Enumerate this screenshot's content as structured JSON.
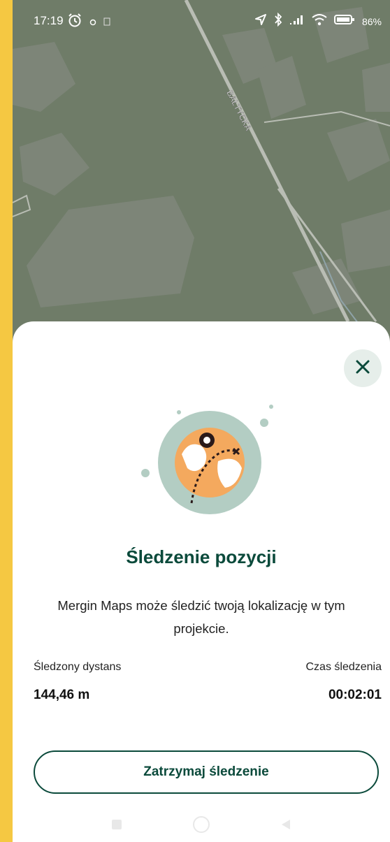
{
  "status_bar": {
    "time": "17:19",
    "battery": "86%",
    "icons": [
      "alarm-icon",
      "notification-dot-icon",
      "image-notification-icon",
      "location-arrow-icon",
      "bluetooth-icon",
      "signal-icon",
      "wifi-icon",
      "battery-icon"
    ]
  },
  "map": {
    "street_label": "BAŁTYCKA",
    "colors": {
      "land": "#6f7c68",
      "areas": "#7d8578",
      "roads": "#b9bdb4"
    }
  },
  "sheet": {
    "title": "Śledzenie pozycji",
    "description": "Mergin Maps może śledzić twoją lokalizację w tym projekcie.",
    "distance_label": "Śledzony dystans",
    "distance_value": "144,46 m",
    "time_label": "Czas śledzenia",
    "time_value": "00:02:01",
    "stop_button_label": "Zatrzymaj śledzenie",
    "colors": {
      "accent": "#0b4a3b",
      "close_bg": "#e6eeea",
      "illustration_circle": "#b3cdc3",
      "globe": "#f4a95e"
    }
  },
  "navbar": {
    "icons": [
      "recent-apps-icon",
      "home-icon",
      "back-icon"
    ]
  }
}
